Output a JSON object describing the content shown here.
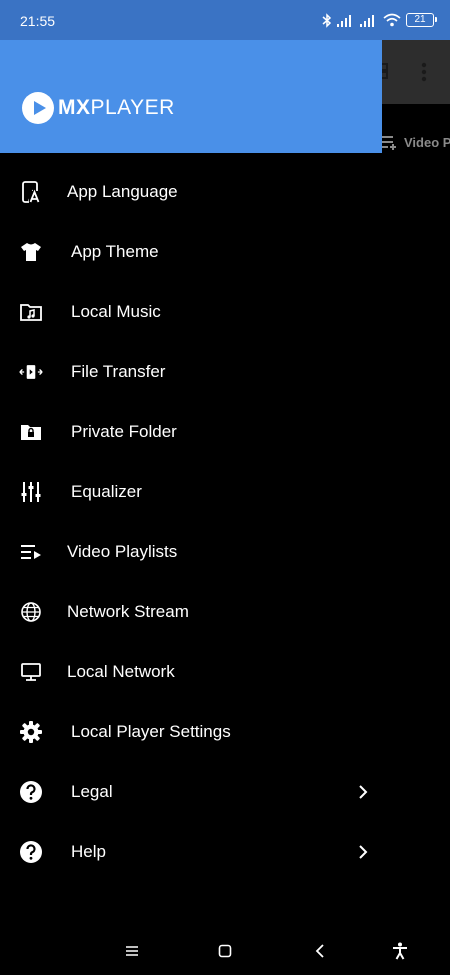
{
  "status_bar": {
    "time": "21:55",
    "battery": "21"
  },
  "background_app": {
    "tab_label": "Video P"
  },
  "drawer": {
    "logo": {
      "brand_bold": "MX",
      "brand_light": "PLAYER"
    },
    "items": [
      {
        "icon": "app-language-icon",
        "label": "App Language",
        "submenu": false
      },
      {
        "icon": "tshirt-icon",
        "label": "App Theme",
        "submenu": false
      },
      {
        "icon": "music-folder-icon",
        "label": "Local Music",
        "submenu": false
      },
      {
        "icon": "file-transfer-icon",
        "label": "File Transfer",
        "submenu": false
      },
      {
        "icon": "lock-folder-icon",
        "label": "Private Folder",
        "submenu": false
      },
      {
        "icon": "equalizer-icon",
        "label": "Equalizer",
        "submenu": false
      },
      {
        "icon": "playlist-icon",
        "label": "Video Playlists",
        "submenu": false
      },
      {
        "icon": "globe-icon",
        "label": "Network Stream",
        "submenu": false
      },
      {
        "icon": "monitor-icon",
        "label": "Local Network",
        "submenu": false
      },
      {
        "icon": "gear-icon",
        "label": "Local Player Settings",
        "submenu": false
      },
      {
        "icon": "help-circle-icon",
        "label": "Legal",
        "submenu": true
      },
      {
        "icon": "help-circle-icon",
        "label": "Help",
        "submenu": true
      }
    ]
  },
  "colors": {
    "status_bar": "#3a73c4",
    "drawer_header": "#4a90e8",
    "drawer_bg": "#000000",
    "text": "#ffffff"
  }
}
